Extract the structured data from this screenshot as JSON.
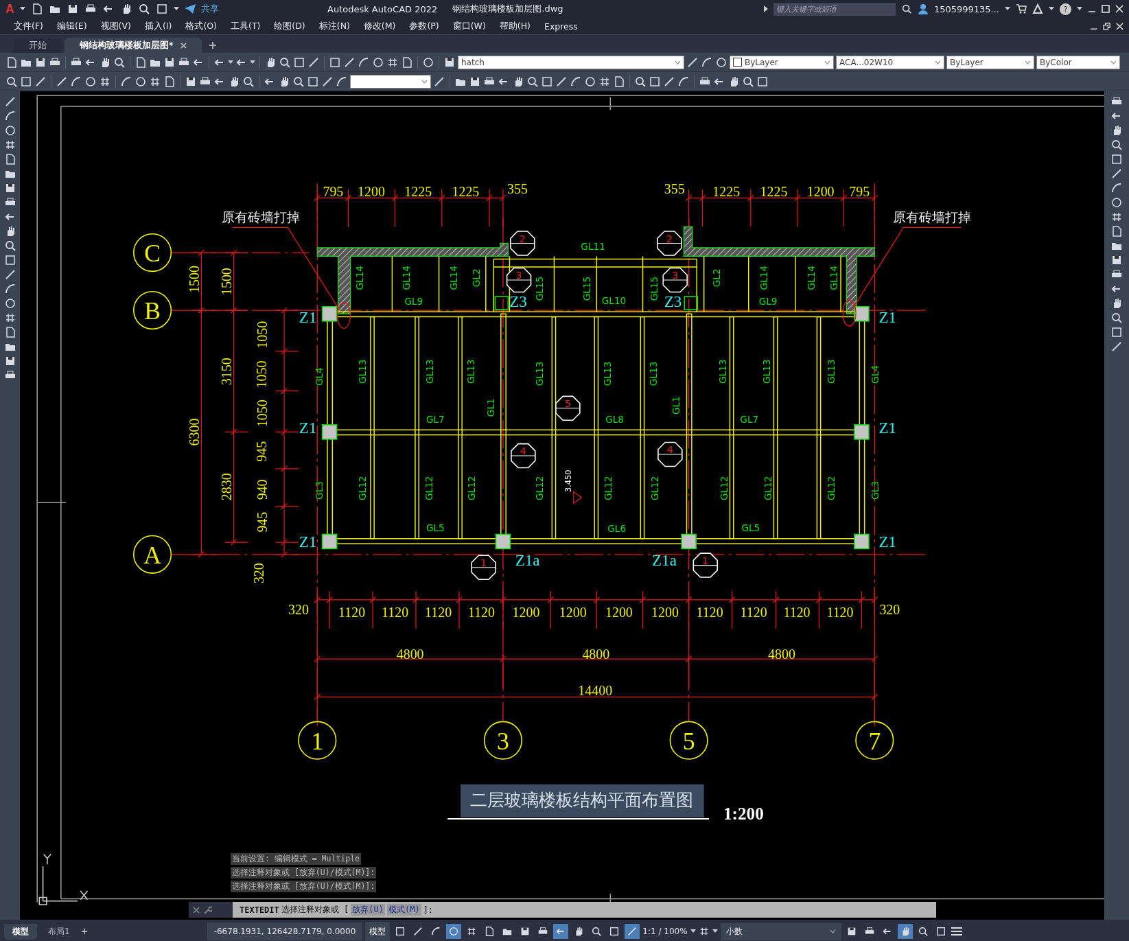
{
  "title_bar": {
    "logo": "A",
    "help": "?",
    "share": "共享",
    "app_title": "Autodesk AutoCAD 2022",
    "file_name": "钢结构玻璃楼板加层图.dwg",
    "search": {
      "placeholder": "键入关键字或短语"
    },
    "user": "1505999135..."
  },
  "menu": [
    "文件(F)",
    "编辑(E)",
    "视图(V)",
    "插入(I)",
    "格式(O)",
    "工具(T)",
    "绘图(D)",
    "标注(N)",
    "修改(M)",
    "参数(P)",
    "窗口(W)",
    "帮助(H)",
    "Express"
  ],
  "doc_tabs": [
    {
      "label": "开始",
      "selected": false
    },
    {
      "label": "钢结构玻璃楼板加层图*",
      "selected": true
    }
  ],
  "properties": {
    "layer": "hatch",
    "color_control": "ByLayer",
    "linetype": "ACA...02W10",
    "lineweight": "ByLayer",
    "plot_style": "ByColor"
  },
  "drawing": {
    "notes": [
      "原有砖墙打掉",
      "原有砖墙打掉"
    ],
    "top_dimensions": [
      "795",
      "1200",
      "1225",
      "1225",
      "355",
      "355",
      "1225",
      "1225",
      "1200",
      "795"
    ],
    "left_dimensions": [
      "1500",
      "1500",
      "6300",
      "3150",
      "2830",
      "1050",
      "1050",
      "1050",
      "945",
      "940",
      "945",
      "320"
    ],
    "bottom_dimensions": [
      "320",
      "1120",
      "1120",
      "1120",
      "1120",
      "1200",
      "1200",
      "1200",
      "1200",
      "1120",
      "1120",
      "1120",
      "1120",
      "320"
    ],
    "span_dimensions": [
      "4800",
      "4800",
      "4800"
    ],
    "total_dimension": "14400",
    "axis_bubbles": [
      "C",
      "B",
      "A",
      "1",
      "3",
      "5",
      "7"
    ],
    "column_labels": [
      "Z1",
      "Z1",
      "Z1",
      "Z1",
      "Z1",
      "Z1",
      "Z3",
      "Z3",
      "Z1a",
      "Z1a"
    ],
    "beam_labels": [
      "GL11",
      "GL14",
      "GL14",
      "GL14",
      "GL2",
      "GL9",
      "GL15",
      "GL15",
      "GL15",
      "GL10",
      "GL2",
      "GL14",
      "GL14",
      "GL14",
      "GL9",
      "GL4",
      "GL13",
      "GL13",
      "GL13",
      "GL13",
      "GL13",
      "GL13",
      "GL13",
      "GL13",
      "GL13",
      "GL4",
      "GL7",
      "GL1",
      "GL8",
      "GL1",
      "GL7",
      "GL3",
      "GL12",
      "GL12",
      "GL12",
      "GL12",
      "GL12",
      "GL12",
      "GL12",
      "GL12",
      "GL12",
      "GL3",
      "GL5",
      "GL6",
      "GL5"
    ],
    "section_markers": [
      "2",
      "2",
      "3",
      "3",
      "5",
      "4",
      "4",
      "1",
      "1"
    ],
    "elevation": "3.450",
    "title": "二层玻璃楼板结构平面布置图",
    "scale": "1:200"
  },
  "command_history": [
    "当前设置: 编辑模式 = Multiple",
    "选择注释对象或 [放弃(U)/模式(M)]:",
    "选择注释对象或 [放弃(U)/模式(M)]:"
  ],
  "command_line": {
    "command": "TEXTEDIT",
    "prompt": "选择注释对象或 [",
    "options": [
      "放弃(U)",
      "模式(M)"
    ],
    "end": "]:"
  },
  "layout_tabs": [
    {
      "label": "模型",
      "selected": true
    },
    {
      "label": "布局1",
      "selected": false
    }
  ],
  "status_bar": {
    "coordinates": "-6678.1931, 126428.7179, 0.0000",
    "space": "模型",
    "toggles": [
      {
        "on": false
      },
      {
        "on": false
      },
      {
        "on": false
      },
      {
        "on": true
      },
      {
        "on": false
      },
      {
        "on": false
      },
      {
        "on": false
      },
      {
        "on": false
      },
      {
        "on": false
      },
      {
        "on": true
      },
      {
        "on": false
      },
      {
        "on": false
      },
      {
        "on": false
      },
      {
        "on": true
      }
    ],
    "annotation_scale": "1:1 / 100%",
    "units": "小数",
    "tools": [
      {
        "on": false
      },
      {
        "on": false
      },
      {
        "on": false
      },
      {
        "on": true
      },
      {
        "on": false
      },
      {
        "on": false
      }
    ]
  }
}
